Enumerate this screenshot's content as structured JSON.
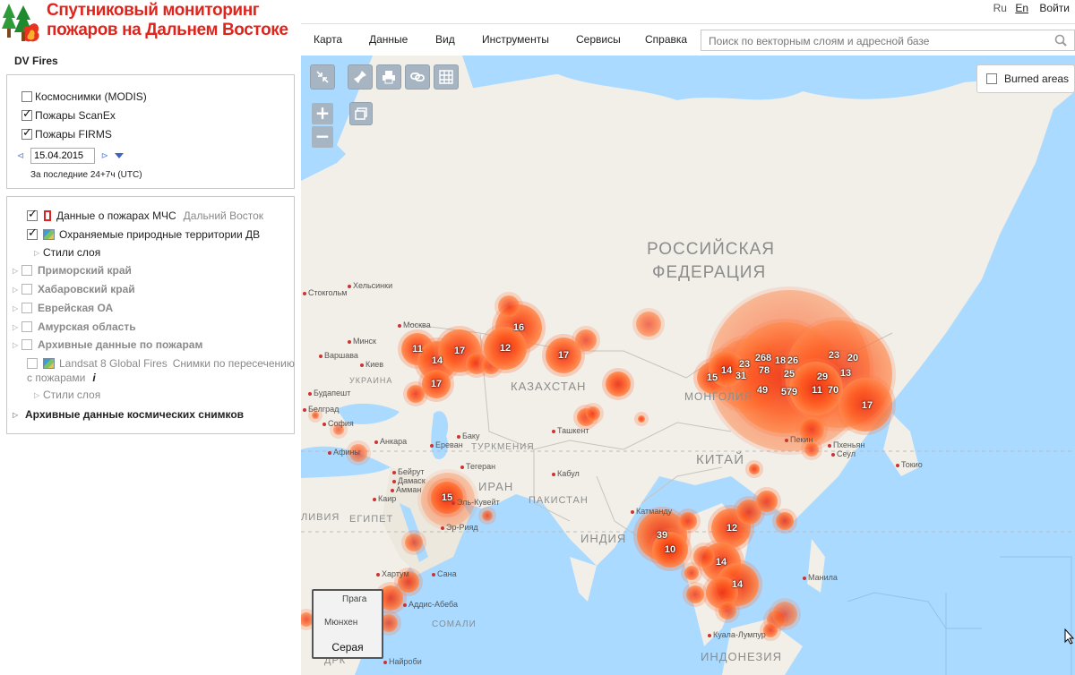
{
  "logo": {
    "line1": "Спутниковый мониторинг",
    "line2": "пожаров на Дальнем Востоке"
  },
  "app_title": "DV Fires",
  "layers_panel": {
    "items": [
      {
        "label": "Космоснимки (MODIS)",
        "checked": false
      },
      {
        "label": "Пожары ScanEx",
        "checked": true
      },
      {
        "label": "Пожары FIRMS",
        "checked": true
      }
    ],
    "date": "15.04.2015",
    "period": "За последние 24+7ч (UTC)"
  },
  "tree": {
    "mchs": {
      "label": "Данные о пожарах МЧС",
      "sub": "Дальний Восток"
    },
    "protected": {
      "label": "Охраняемые природные территории ДВ"
    },
    "styles1": "Стили слоя",
    "primorsky": "Приморский край",
    "khabarovsk": "Хабаровский край",
    "jewish": "Еврейская ОА",
    "amur": "Амурская область",
    "archive": "Архивные данные по пожарам",
    "landsat": {
      "label": "Landsat 8 Global Fires",
      "sub": "Снимки по пересечению",
      "sub2": "с пожарами",
      "info": "i"
    },
    "styles2": "Стили слоя",
    "space_archive": "Архивные данные космических снимков"
  },
  "topbar": {
    "lang_ru": "Ru",
    "lang_en": "En",
    "login": "Войти",
    "menu": [
      "Карта",
      "Данные",
      "Вид",
      "Инструменты",
      "Сервисы",
      "Справка"
    ],
    "search_placeholder": "Поиск по векторным слоям и адресной базе"
  },
  "map": {
    "zoom_in": "+",
    "zoom_out": "−",
    "burned_areas": "Burned areas",
    "minimap_label": "Серая",
    "minimap_cities": [
      "Прага",
      "Мюнхен"
    ],
    "countries": {
      "russia1": "РОССИЙСКАЯ",
      "russia2": "ФЕДЕРАЦИЯ",
      "kazakhstan": "КАЗАХСТАН",
      "mongolia": "МОНГОЛИЯ",
      "china": "КИТАЙ",
      "india": "ИНДИЯ",
      "pakistan": "ПАКИСТАН",
      "turkmenia": "ТУРКМЕНИЯ",
      "iran": "ИРАН",
      "egypt": "ЕГИПЕТ",
      "libya": "ЛИВИЯ",
      "somali": "СОМАЛИ",
      "indonesia": "ИНДОНЕЗИЯ",
      "ukraine": "УКРАИНА",
      "drk": "ДРК"
    },
    "cities": {
      "helsinki": "Хельсинки",
      "stockholm": "Стокгольм",
      "moscow": "Москва",
      "minsk": "Минск",
      "warsaw": "Варшава",
      "kyiv": "Киев",
      "budapest": "Будапешт",
      "belgrade": "Белград",
      "sofia": "София",
      "ankara": "Анкара",
      "athens": "Афины",
      "baku": "Баку",
      "yerevan": "Ереван",
      "tehran": "Тегеран",
      "beirut": "Бейрут",
      "damascus": "Дамаск",
      "amman": "Амман",
      "cairo": "Каир",
      "kuwait": "Эль-Кувейт",
      "riyadh": "Эр-Рияд",
      "tashkent": "Ташкент",
      "kabul": "Кабул",
      "kathmandu": "Катманду",
      "beijing": "Пекин",
      "pyongyang": "Пхеньян",
      "seoul": "Сеул",
      "tokyo": "Токио",
      "manila": "Манила",
      "kuala": "Куала-Лумпур",
      "khartoum": "Хартум",
      "sana": "Сана",
      "addis": "Аддис-Абеба",
      "nairobi": "Найроби"
    }
  },
  "fire_clusters": [
    {
      "count": "11"
    },
    {
      "count": "14"
    },
    {
      "count": "17"
    },
    {
      "count": "17"
    },
    {
      "count": "16"
    },
    {
      "count": "12"
    },
    {
      "count": "17"
    },
    {
      "count": "15"
    },
    {
      "count": "15"
    },
    {
      "count": "14"
    },
    {
      "count": "23"
    },
    {
      "count": "31"
    },
    {
      "count": "268"
    },
    {
      "count": "18"
    },
    {
      "count": "26"
    },
    {
      "count": "78"
    },
    {
      "count": "25"
    },
    {
      "count": "49"
    },
    {
      "count": "579"
    },
    {
      "count": "23"
    },
    {
      "count": "20"
    },
    {
      "count": "13"
    },
    {
      "count": "29"
    },
    {
      "count": "11"
    },
    {
      "count": "70"
    },
    {
      "count": "17"
    },
    {
      "count": "39"
    },
    {
      "count": "10"
    },
    {
      "count": "12"
    },
    {
      "count": "14"
    },
    {
      "count": "14"
    }
  ],
  "colors": {
    "logo_red": "#e0241b",
    "fire_orange": "#ff5a1e",
    "fire_red": "#e8260f",
    "map_water": "#aadaff",
    "map_land": "#f1efe8"
  }
}
